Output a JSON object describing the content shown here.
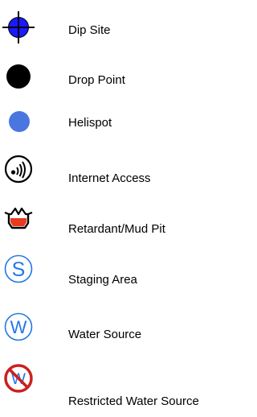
{
  "legend": {
    "items": [
      {
        "label": "Dip Site",
        "icon": "crosshair-circle-icon",
        "color": "#0000ff"
      },
      {
        "label": "Drop Point",
        "icon": "filled-circle-icon",
        "color": "#000000"
      },
      {
        "label": "Helispot",
        "icon": "filled-circle-icon",
        "color": "#4a76e0"
      },
      {
        "label": "Internet Access",
        "icon": "wireless-signal-icon",
        "color": "#000000"
      },
      {
        "label": "Retardant/Mud Pit",
        "icon": "retardant-pit-icon",
        "color": "#e83a1e"
      },
      {
        "label": "Staging Area",
        "icon": "circled-letter-s-icon",
        "color": "#2277e8"
      },
      {
        "label": "Water Source",
        "icon": "circled-letter-w-icon",
        "color": "#2277e8"
      },
      {
        "label": "Restricted Water Source",
        "icon": "prohibited-water-source-icon",
        "color": "#cc1f1f"
      }
    ]
  }
}
